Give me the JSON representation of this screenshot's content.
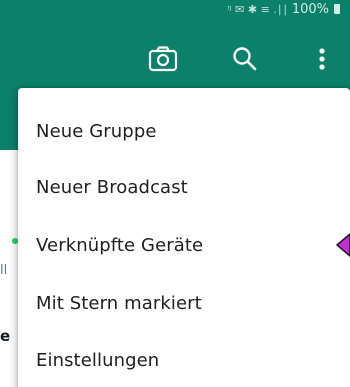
{
  "status_bar": {
    "signal_glyphs": "ᵑ ✉ ✱ ≡ .∣∣",
    "battery_percent": "100%"
  },
  "toolbar": {
    "icons": [
      "camera-icon",
      "search-icon",
      "more-vert-icon"
    ]
  },
  "background_fragments": {
    "line_1": "ll",
    "line_2": "e"
  },
  "menu": {
    "items": [
      {
        "label": "Neue Gruppe"
      },
      {
        "label": "Neuer Broadcast"
      },
      {
        "label": "Verknüpfte Geräte"
      },
      {
        "label": "Mit Stern markiert"
      },
      {
        "label": "Einstellungen"
      }
    ]
  },
  "colors": {
    "app_bar": "#0b806a",
    "menu_text": "#202020",
    "pointer_arrow": "#c52bd6"
  }
}
